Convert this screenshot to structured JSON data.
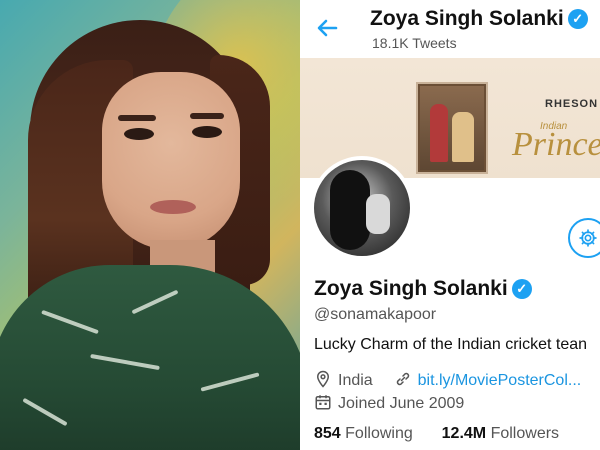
{
  "header": {
    "back_icon": "back-arrow-icon",
    "name": "Zoya Singh Solanki",
    "tweets_count": "18.1K Tweets",
    "accent_color": "#1da1f2"
  },
  "banner": {
    "brand": "RHESON",
    "tagline_small": "Indian",
    "tagline_big": "Prince"
  },
  "profile": {
    "name": "Zoya Singh Solanki",
    "handle": "@sonamakapoor",
    "bio": "Lucky Charm of the Indian cricket tean",
    "location": "India",
    "link": "bit.ly/MoviePosterCol...",
    "joined": "Joined June 2009",
    "following_count": "854",
    "following_label": "Following",
    "followers_count": "12.4M",
    "followers_label": "Followers"
  },
  "icons": {
    "verified": "verified-badge-icon",
    "settings": "gear-icon",
    "location": "location-pin-icon",
    "link": "link-icon",
    "calendar": "calendar-icon"
  }
}
